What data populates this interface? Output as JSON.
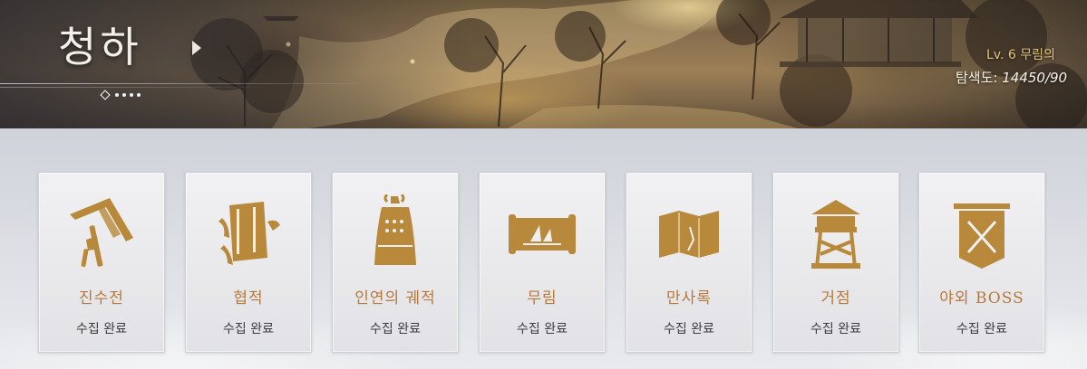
{
  "banner": {
    "region_name": "청하",
    "level_text": "Lv. 6  무림의 ",
    "explore_label": "탐색도: ",
    "explore_value": "14450/90"
  },
  "cards": [
    {
      "title": "진수전",
      "status": "수집 완료",
      "icon": "hat-icon"
    },
    {
      "title": "협적",
      "status": "수집 완료",
      "icon": "book-icon"
    },
    {
      "title": "인연의 궤적",
      "status": "수집 완료",
      "icon": "bell-icon"
    },
    {
      "title": "무림",
      "status": "수집 완료",
      "icon": "scroll-icon"
    },
    {
      "title": "만사록",
      "status": "수집 완료",
      "icon": "map-icon"
    },
    {
      "title": "거점",
      "status": "수집 완료",
      "icon": "watchtower-icon"
    },
    {
      "title": "야외 BOSS",
      "status": "수집 완료",
      "icon": "crossed-swords-banner-icon"
    }
  ],
  "colors": {
    "gold_icon": "#b8893a",
    "card_title": "#b7783a",
    "level_text": "#e0c37a"
  }
}
